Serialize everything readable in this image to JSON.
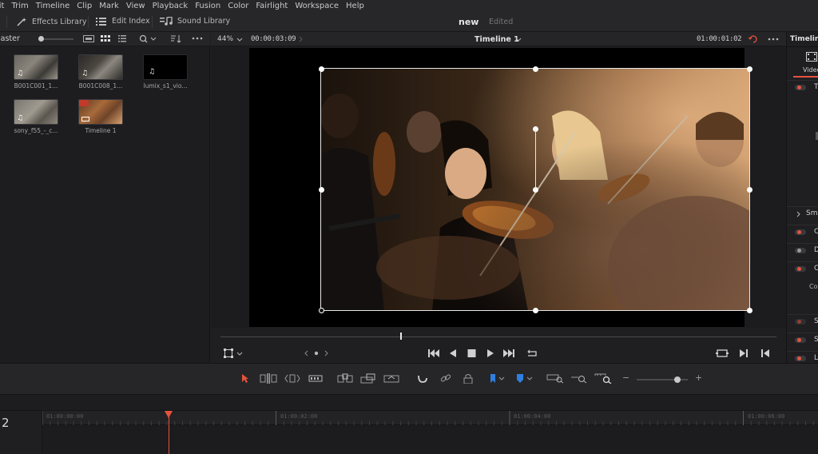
{
  "menu": [
    "lit",
    "Trim",
    "Timeline",
    "Clip",
    "Mark",
    "View",
    "Playback",
    "Fusion",
    "Color",
    "Fairlight",
    "Workspace",
    "Help"
  ],
  "toolbar": {
    "effects_library": "Effects Library",
    "edit_index": "Edit Index",
    "sound_library": "Sound Library",
    "project_name": "new",
    "project_status": "Edited"
  },
  "media_pool": {
    "title": "laster",
    "clips": [
      {
        "label": "B001C001_1...",
        "kind": "video"
      },
      {
        "label": "B001C008_1...",
        "kind": "video"
      },
      {
        "label": "lumix_s1_vio...",
        "kind": "audio"
      },
      {
        "label": "sony_f55_-_c...",
        "kind": "video"
      },
      {
        "label": "Timeline 1",
        "kind": "timeline"
      }
    ]
  },
  "viewer": {
    "zoom": "44%",
    "source_timecode": "00:00:03:09",
    "timeline_name": "Timeline 1",
    "record_timecode": "01:00:01:02",
    "playhead_fraction": 0.34
  },
  "inspector": {
    "title": "Timeline",
    "tab_video": "Video",
    "rows": [
      {
        "label": "T",
        "on": true
      },
      {
        "label": "Sma",
        "on": null
      },
      {
        "label": "C",
        "on": true
      },
      {
        "label": "D",
        "on": false
      },
      {
        "label": "C",
        "on": true
      },
      {
        "label": "Co",
        "on": null
      },
      {
        "label": "S",
        "on": true
      },
      {
        "label": "S",
        "on": true
      },
      {
        "label": "L",
        "on": true
      }
    ]
  },
  "timeline": {
    "track_number": "2",
    "ruler_ticks": [
      "01:00:00:00",
      "01:00:02:00",
      "01:00:04:00",
      "01:00:06:00"
    ],
    "playhead_position": "01:00:01:02"
  },
  "colors": {
    "accent_red": "#e5533d",
    "accent_blue": "#2f7fe0",
    "panel_bg": "#1f1f22"
  }
}
